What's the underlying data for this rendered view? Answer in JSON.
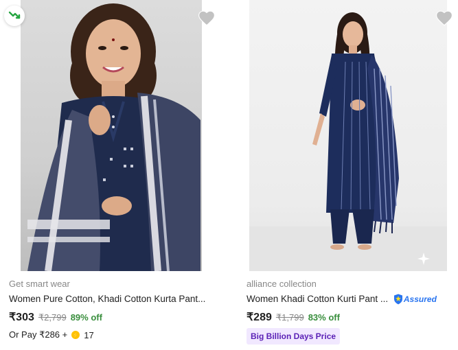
{
  "products": [
    {
      "brand": "Get smart wear",
      "title": "Women Pure Cotton, Khadi Cotton Kurta Pant...",
      "price": "₹303",
      "mrp": "₹2,799",
      "discount": "89% off",
      "pay_prefix": "Or Pay ₹286 +",
      "coins": "17",
      "image_alt": "model wearing navy kurta with white border dupatta",
      "wishlist_icon": "heart-icon",
      "trend_icon": "trending-down-icon"
    },
    {
      "brand": "alliance collection",
      "title": "Women Khadi Cotton Kurti Pant ...",
      "assured_label": "Assured",
      "price": "₹289",
      "mrp": "₹1,799",
      "discount": "83% off",
      "offer_tag": "Big Billion Days Price",
      "image_alt": "model wearing navy striped kurta set",
      "wishlist_icon": "heart-icon"
    }
  ],
  "colors": {
    "price_off": "#388e3c",
    "brand_text": "#878787",
    "assured_blue": "#2874f0",
    "offer_tag_bg": "#f1e8ff",
    "offer_tag_text": "#5b21b6"
  }
}
